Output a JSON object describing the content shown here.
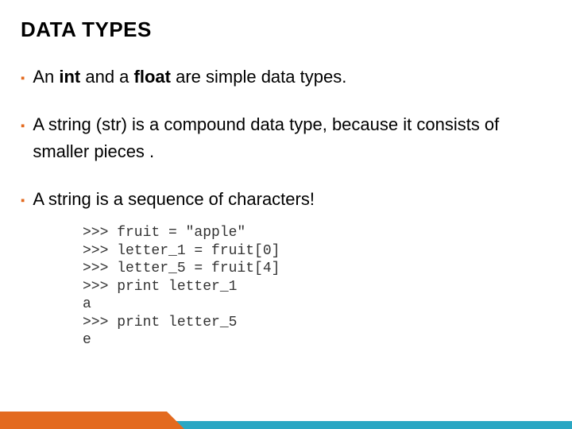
{
  "title": "DATA TYPES",
  "bullets": [
    {
      "pre": "An ",
      "b1": "int",
      "mid": " and a ",
      "b2": "float",
      "post": " are simple data types."
    },
    {
      "text": "A string (str) is a compound data type, because it consists of smaller pieces ."
    },
    {
      "text": "A string is a sequence of characters!"
    }
  ],
  "code": ">>> fruit = \"apple\"\n>>> letter_1 = fruit[0]\n>>> letter_5 = fruit[4]\n>>> print letter_1\na\n>>> print letter_5\ne"
}
